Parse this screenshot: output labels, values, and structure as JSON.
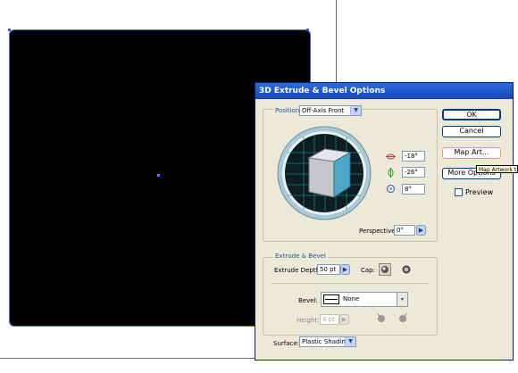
{
  "dialog": {
    "title": "3D Extrude & Bevel Options",
    "ok": "OK",
    "cancel": "Cancel",
    "map_art": "Map Art...",
    "more_options": "More Options",
    "preview": "Preview",
    "preview_checked": false
  },
  "position": {
    "label": "Position:",
    "value": "Off-Axis Front",
    "rotate_x": "-18°",
    "rotate_y": "-26°",
    "rotate_z": "8°",
    "perspective_label": "Perspective:",
    "perspective_value": "0°"
  },
  "extrude": {
    "section": "Extrude & Bevel",
    "depth_label": "Extrude Depth:",
    "depth_value": "50 pt",
    "cap_label": "Cap:",
    "bevel_label": "Bevel:",
    "bevel_value": "None",
    "height_label": "Height:",
    "height_value": "4 pt"
  },
  "surface": {
    "label": "Surface:",
    "value": "Plastic Shading"
  },
  "tooltip": "Map Artwork t",
  "colors": {
    "artwork": "#000000",
    "selection": "#3c54d6",
    "cube_front": "#4fa6c8",
    "cube_side": "#c8c8cc",
    "titlebar": "#1f58cc"
  }
}
